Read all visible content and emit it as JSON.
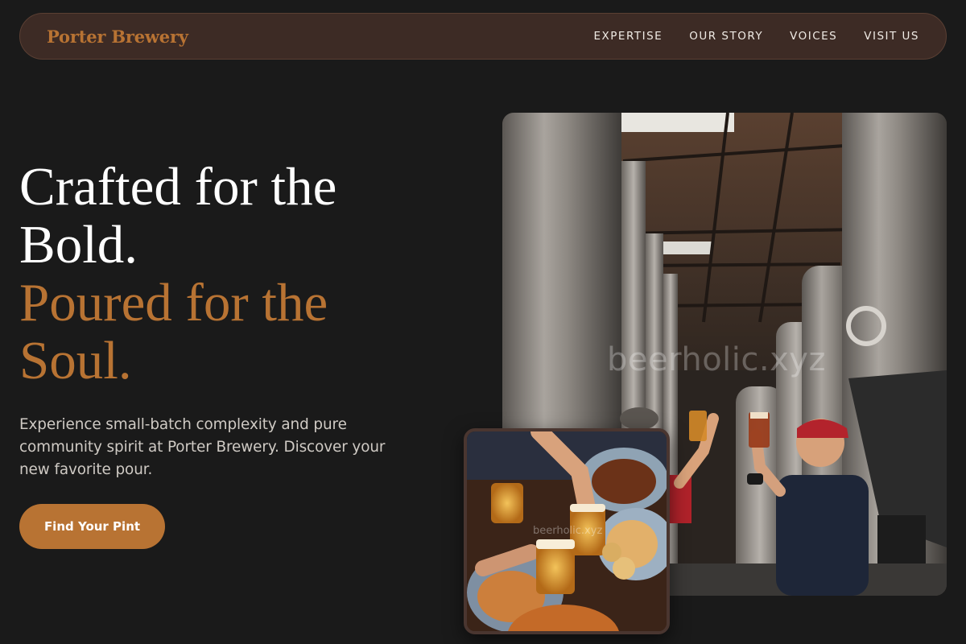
{
  "brand": {
    "name": "Porter Brewery",
    "accent": "#b87333",
    "background": "#1a1a1a",
    "nav_bg": "#3d2b25"
  },
  "nav": {
    "links": [
      {
        "label": "EXPERTISE"
      },
      {
        "label": "OUR STORY"
      },
      {
        "label": "VOICES"
      },
      {
        "label": "VISIT US"
      }
    ]
  },
  "hero": {
    "headline_line1": "Crafted for the",
    "headline_line2": "Bold.",
    "headline_accent1": "Poured for the",
    "headline_accent2": "Soul.",
    "subtext": "Experience small-batch complexity and pure community spirit at Porter Brewery. Discover your new favorite pour.",
    "cta_label": "Find Your Pint"
  },
  "images": {
    "main_watermark": "beerholic.xyz",
    "overlay_watermark": "beerholic.xyz"
  }
}
